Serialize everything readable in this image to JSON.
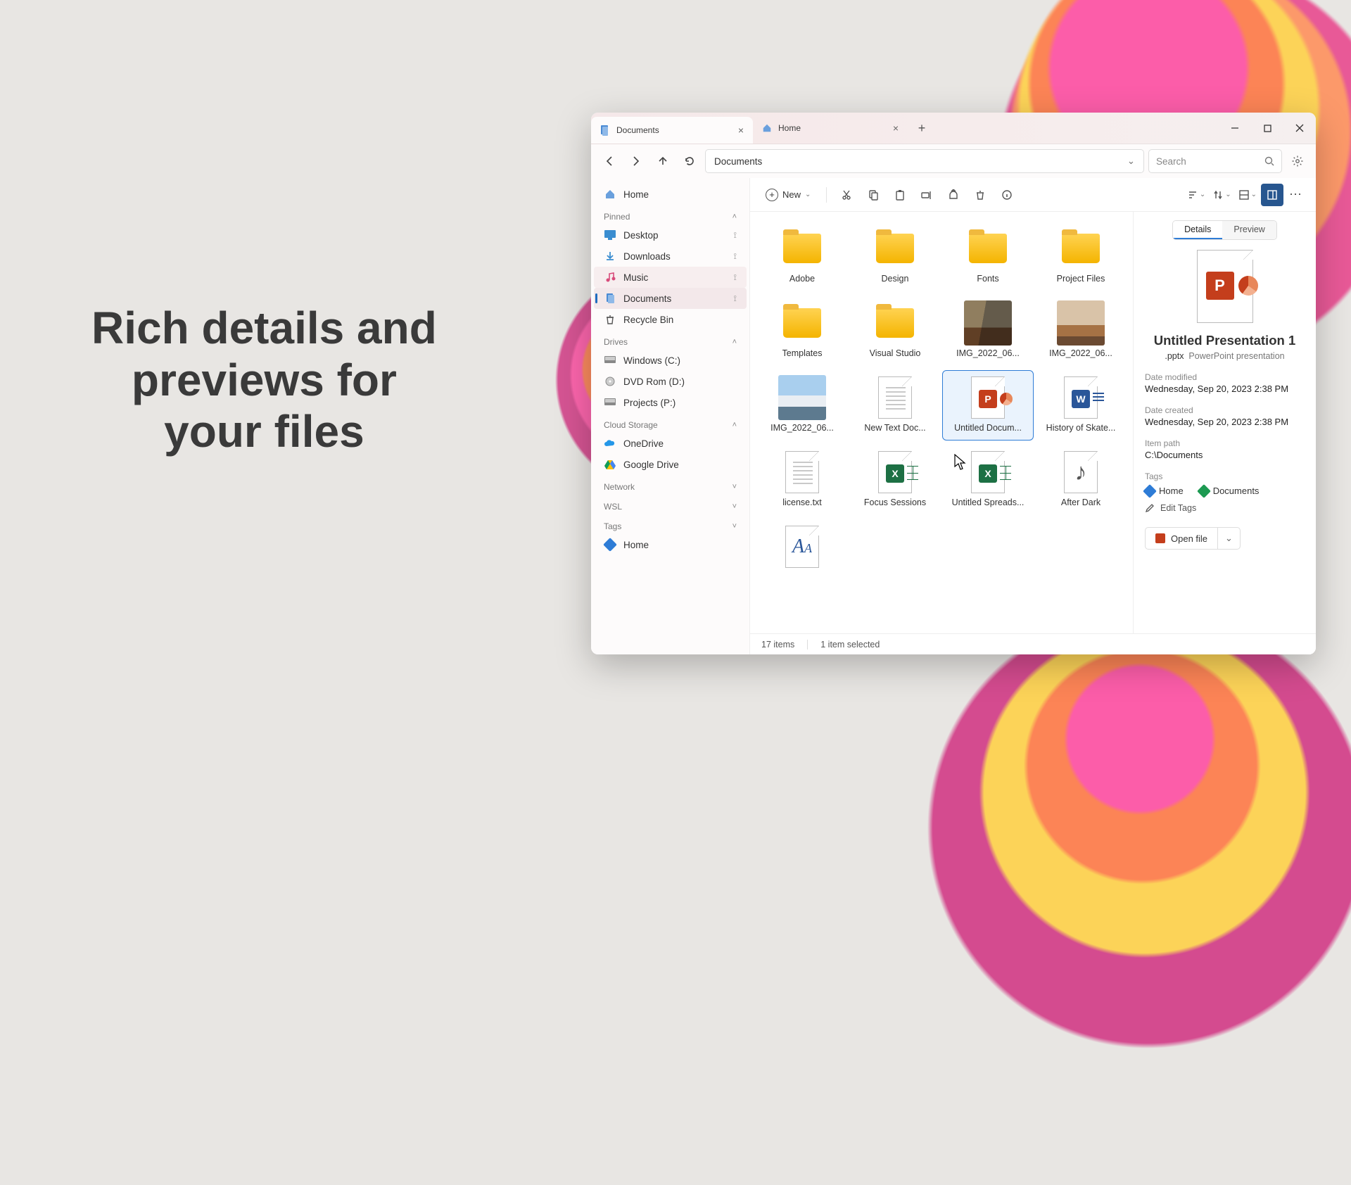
{
  "marketing_text": "Rich details and previews for your files",
  "tabs": [
    {
      "label": "Documents",
      "icon": "documents-icon",
      "active": true
    },
    {
      "label": "Home",
      "icon": "home-icon",
      "active": false
    }
  ],
  "address": "Documents",
  "search_placeholder": "Search",
  "toolbar": {
    "new_label": "New"
  },
  "sidebar": {
    "home": "Home",
    "headers": {
      "pinned": "Pinned",
      "drives": "Drives",
      "cloud": "Cloud Storage",
      "network": "Network",
      "wsl": "WSL",
      "tags": "Tags"
    },
    "pinned": [
      "Desktop",
      "Downloads",
      "Music",
      "Documents",
      "Recycle Bin"
    ],
    "drives": [
      "Windows (C:)",
      "DVD Rom (D:)",
      "Projects (P:)"
    ],
    "cloud": [
      "OneDrive",
      "Google Drive"
    ],
    "tags": [
      "Home"
    ]
  },
  "files": [
    {
      "name": "Adobe",
      "type": "folder"
    },
    {
      "name": "Design",
      "type": "folder"
    },
    {
      "name": "Fonts",
      "type": "folder"
    },
    {
      "name": "Project Files",
      "type": "folder"
    },
    {
      "name": "Templates",
      "type": "folder"
    },
    {
      "name": "Visual Studio",
      "type": "folder"
    },
    {
      "name": "IMG_2022_06...",
      "type": "photo1"
    },
    {
      "name": "IMG_2022_06...",
      "type": "photo2"
    },
    {
      "name": "IMG_2022_06...",
      "type": "photo3"
    },
    {
      "name": "New Text Doc...",
      "type": "txt"
    },
    {
      "name": "Untitled Docum...",
      "type": "ppt",
      "selected": true
    },
    {
      "name": "History of Skate...",
      "type": "word"
    },
    {
      "name": "license.txt",
      "type": "txt"
    },
    {
      "name": "Focus Sessions",
      "type": "xls"
    },
    {
      "name": "Untitled Spreads...",
      "type": "xls"
    },
    {
      "name": "After Dark",
      "type": "audio"
    },
    {
      "name": "",
      "type": "font"
    }
  ],
  "details": {
    "tab_details": "Details",
    "tab_preview": "Preview",
    "title": "Untitled Presentation 1",
    "ext": ".pptx",
    "kind": "PowerPoint presentation",
    "modified_label": "Date modified",
    "modified": "Wednesday, Sep 20, 2023 2:38 PM",
    "created_label": "Date created",
    "created": "Wednesday, Sep 20, 2023 2:38 PM",
    "path_label": "Item path",
    "path": "C:\\Documents",
    "tags_label": "Tags",
    "tag1": "Home",
    "tag2": "Documents",
    "edit_tags": "Edit Tags",
    "open_file": "Open file"
  },
  "status": {
    "count": "17 items",
    "selected": "1 item selected"
  }
}
